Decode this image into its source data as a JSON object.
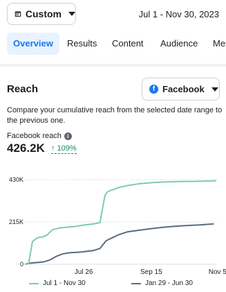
{
  "header": {
    "date_preset": "Custom",
    "date_range": "Jul 1 - Nov 30, 2023",
    "icons": {
      "calendar": "calendar-icon",
      "caret": "chevron-down-icon"
    }
  },
  "tabs": [
    {
      "label": "Overview",
      "active": true
    },
    {
      "label": "Results",
      "active": false
    },
    {
      "label": "Content",
      "active": false
    },
    {
      "label": "Audience",
      "active": false
    },
    {
      "label": "Mes",
      "active": false
    }
  ],
  "reach": {
    "title": "Reach",
    "platform": "Facebook",
    "description": "Compare your cumulative reach from the selected date range to the previous one.",
    "metric_label": "Facebook reach",
    "metric_value": "426.2K",
    "metric_change": "109%",
    "change_direction": "up"
  },
  "colors": {
    "accent": "#1877f2",
    "tab_active_bg": "#e7f3ff",
    "positive": "#138a5a",
    "current_series": "#7fc8b9",
    "previous_series": "#5b6a7e"
  },
  "chart_data": {
    "type": "line",
    "y_ticks": [
      "0",
      "215K",
      "430K"
    ],
    "x_ticks": [
      "Jul 26",
      "Sep 15",
      "Nov 5"
    ],
    "ylim": [
      0,
      430000
    ],
    "grid": true,
    "legend_position": "bottom",
    "series": [
      {
        "name": "Jul 1 - Nov 30",
        "color": "#7fc8b9",
        "x": [
          0,
          3,
          6,
          10,
          15,
          18,
          22,
          28,
          33,
          40,
          48,
          55,
          60,
          64,
          66,
          68,
          71,
          75,
          82,
          92,
          102,
          112,
          122,
          132,
          142,
          151,
          153
        ],
        "values": [
          0,
          2000,
          115000,
          135000,
          140000,
          150000,
          175000,
          185000,
          188000,
          192000,
          200000,
          205000,
          212000,
          350000,
          368000,
          374000,
          380000,
          390000,
          400000,
          410000,
          415000,
          418000,
          420000,
          421000,
          422000,
          424000,
          426200
        ]
      },
      {
        "name": "Jan 29 - Jun 30",
        "color": "#5b6a7e",
        "x": [
          0,
          3,
          8,
          15,
          20,
          25,
          30,
          35,
          45,
          55,
          60,
          65,
          70,
          75,
          82,
          90,
          100,
          110,
          120,
          130,
          140,
          151
        ],
        "values": [
          0,
          5000,
          8000,
          12000,
          22000,
          40000,
          52000,
          58000,
          62000,
          70000,
          80000,
          120000,
          135000,
          150000,
          165000,
          172000,
          180000,
          188000,
          193000,
          197000,
          200000,
          205000
        ]
      }
    ]
  }
}
